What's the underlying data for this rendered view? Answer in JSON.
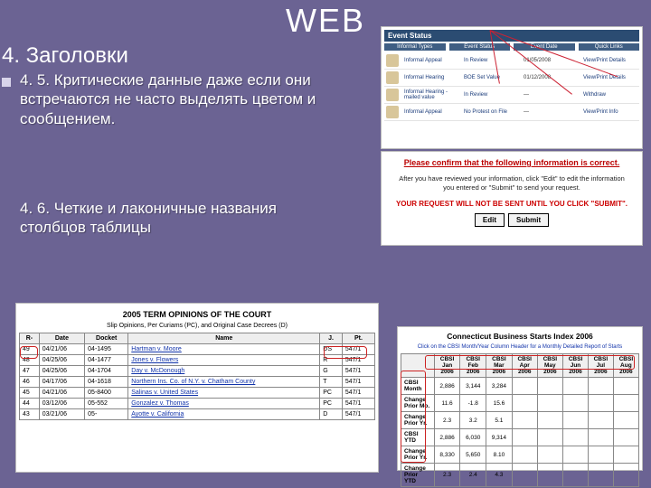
{
  "title": "WEB",
  "section_heading": "4. Заголовки",
  "bullet_text": "4. 5. Критические данные даже если они встречаются не часто выделять цветом и сообщением.",
  "second_text": "4. 6. Четкие и лаконичные названия столбцов таблицы",
  "shot1": {
    "header": "Event Status",
    "cols": [
      "Informal Types",
      "Event Status",
      "Event Date",
      "Quick Links"
    ],
    "rows": [
      {
        "c1": "Informal Appeal",
        "c2": "In Review",
        "c3": "01/05/2008",
        "c4": "View/Print Details"
      },
      {
        "c1": "Informal Hearing",
        "c2": "BOE Set Value",
        "c3": "01/12/2008",
        "c4": "View/Print Details"
      },
      {
        "c1": "Informal Hearing - mailed value",
        "c2": "In Review",
        "c3": "—",
        "c4": "Withdraw"
      },
      {
        "c1": "Informal Appeal",
        "c2": "No Protest on File",
        "c3": "—",
        "c4": "View/Print Info"
      }
    ]
  },
  "shot2": {
    "title": "Please confirm that the following information is correct.",
    "body": "After you have reviewed your information, click \"Edit\" to edit the information you entered or \"Submit\" to send your request.",
    "warn": "YOUR REQUEST WILL NOT BE SENT UNTIL YOU CLICK \"SUBMIT\".",
    "btn_edit": "Edit",
    "btn_submit": "Submit"
  },
  "shot3": {
    "title": "2005 TERM OPINIONS OF THE COURT",
    "subtitle": "Slip Opinions, Per Curiams (PC), and Original Case Decrees (D)",
    "headers": [
      "R-",
      "Date",
      "Docket",
      "Name",
      "J.",
      "Pt."
    ],
    "rows": [
      {
        "r": "49",
        "date": "04/21/06",
        "docket": "04-1495",
        "name": "Hartman v. Moore",
        "j": "DS",
        "pt": "547/1"
      },
      {
        "r": "48",
        "date": "04/25/06",
        "docket": "04-1477",
        "name": "Jones v. Flowers",
        "j": "R",
        "pt": "547/1"
      },
      {
        "r": "47",
        "date": "04/25/06",
        "docket": "04-1704",
        "name": "Day v. McDonough",
        "j": "G",
        "pt": "547/1"
      },
      {
        "r": "46",
        "date": "04/17/06",
        "docket": "04-1618",
        "name": "Northern Ins. Co. of N.Y. v. Chatham County",
        "j": "T",
        "pt": "547/1"
      },
      {
        "r": "45",
        "date": "04/21/06",
        "docket": "05-8400",
        "name": "Salinas v. United States",
        "j": "PC",
        "pt": "547/1"
      },
      {
        "r": "44",
        "date": "03/12/06",
        "docket": "05-552",
        "name": "Gonzalez v. Thomas",
        "j": "PC",
        "pt": "547/1"
      },
      {
        "r": "43",
        "date": "03/21/06",
        "docket": "05-",
        "name": "Ayotte v. California",
        "j": "D",
        "pt": "547/1"
      }
    ]
  },
  "shot4": {
    "title": "Connecticut Business Starts Index 2006",
    "subtitle": "Click on the CBSI Month/Year Column Header for a Monthly Detailed Report of Starts",
    "col_headers": [
      "",
      "CBSI Jan 2006",
      "CBSI Feb 2006",
      "CBSI Mar 2006",
      "CBSI Apr 2006",
      "CBSI May 2006",
      "CBSI Jun 2006",
      "CBSI Jul 2006",
      "CBSI Aug 2006"
    ],
    "rows": [
      {
        "label": "CBSI Month",
        "v": [
          "2,886",
          "3,144",
          "3,284",
          "",
          "",
          "",
          "",
          ""
        ]
      },
      {
        "label": "Change Prior Mo.",
        "v": [
          "11.6",
          "-1.8",
          "15.6",
          "",
          "",
          "",
          "",
          ""
        ]
      },
      {
        "label": "Change Prior Yr.",
        "v": [
          "2.3",
          "3.2",
          "5.1",
          "",
          "",
          "",
          "",
          ""
        ]
      },
      {
        "label": "CBSI YTD",
        "v": [
          "2,886",
          "6,030",
          "9,314",
          "",
          "",
          "",
          "",
          ""
        ]
      },
      {
        "label": "Change Prior Yr.",
        "v": [
          "8,330",
          "5,650",
          "8.10",
          "",
          "",
          "",
          "",
          ""
        ]
      },
      {
        "label": "Change Prior YTD",
        "v": [
          "2.3",
          "2.4",
          "4.3",
          "",
          "",
          "",
          "",
          ""
        ]
      }
    ]
  }
}
